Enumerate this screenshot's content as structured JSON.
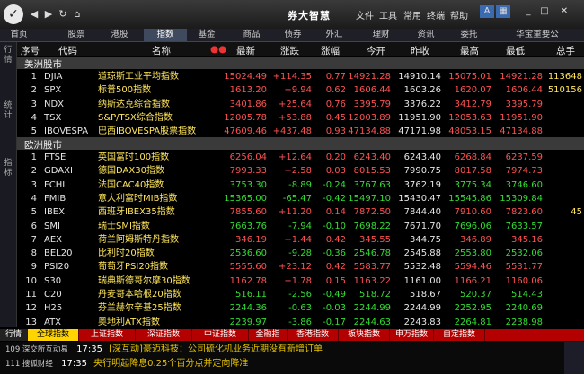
{
  "title": "券大智慧",
  "menu": [
    "文件",
    "工具",
    "常用",
    "终端",
    "帮助"
  ],
  "nav_tabs": [
    "首页",
    "股票",
    "港股",
    "指数",
    "基金",
    "商品",
    "债券",
    "外汇",
    "理财",
    "资讯",
    "委托",
    "华宝重要公"
  ],
  "sidebar_tabs": [
    "行情",
    "统计",
    "指标"
  ],
  "headers": [
    "序号",
    "代码",
    "名称",
    "最新",
    "涨跌",
    "涨幅",
    "今开",
    "昨收",
    "最高",
    "最低",
    "总手"
  ],
  "sections": {
    "americas": "美洲股市",
    "europe": "欧洲股市"
  },
  "americas": [
    {
      "n": "1",
      "code": "DJIA",
      "name": "道琼斯工业平均指数",
      "last": "15024.49",
      "chg": "+114.35",
      "pct": "0.77",
      "open": "14921.28",
      "prev": "14910.14",
      "high": "15075.01",
      "low": "14921.28",
      "vol": "113648",
      "dir": "up"
    },
    {
      "n": "2",
      "code": "SPX",
      "name": "标普500指数",
      "last": "1613.20",
      "chg": "+9.94",
      "pct": "0.62",
      "open": "1606.44",
      "prev": "1603.26",
      "high": "1620.07",
      "low": "1606.44",
      "vol": "510156",
      "dir": "up"
    },
    {
      "n": "3",
      "code": "NDX",
      "name": "纳斯达克综合指数",
      "last": "3401.86",
      "chg": "+25.64",
      "pct": "0.76",
      "open": "3395.79",
      "prev": "3376.22",
      "high": "3412.79",
      "low": "3395.79",
      "vol": "",
      "dir": "up"
    },
    {
      "n": "4",
      "code": "TSX",
      "name": "S&P/TSX综合指数",
      "last": "12005.78",
      "chg": "+53.88",
      "pct": "0.45",
      "open": "12003.89",
      "prev": "11951.90",
      "high": "12053.63",
      "low": "11951.90",
      "vol": "",
      "dir": "up"
    },
    {
      "n": "5",
      "code": "IBOVESPA",
      "name": "巴西IBOVESPA股票指数",
      "last": "47609.46",
      "chg": "+437.48",
      "pct": "0.93",
      "open": "47134.88",
      "prev": "47171.98",
      "high": "48053.15",
      "low": "47134.88",
      "vol": "",
      "dir": "up"
    }
  ],
  "europe": [
    {
      "n": "1",
      "code": "FTSE",
      "name": "英国富时100指数",
      "last": "6256.04",
      "chg": "+12.64",
      "pct": "0.20",
      "open": "6243.40",
      "prev": "6243.40",
      "high": "6268.84",
      "low": "6237.59",
      "vol": "",
      "dir": "up"
    },
    {
      "n": "2",
      "code": "GDAXI",
      "name": "德国DAX30指数",
      "last": "7993.33",
      "chg": "+2.58",
      "pct": "0.03",
      "open": "8015.53",
      "prev": "7990.75",
      "high": "8017.58",
      "low": "7974.73",
      "vol": "",
      "dir": "up"
    },
    {
      "n": "3",
      "code": "FCHI",
      "name": "法国CAC40指数",
      "last": "3753.30",
      "chg": "-8.89",
      "pct": "-0.24",
      "open": "3767.63",
      "prev": "3762.19",
      "high": "3775.34",
      "low": "3746.60",
      "vol": "",
      "dir": "dn"
    },
    {
      "n": "4",
      "code": "FMIB",
      "name": "意大利富时MIB指数",
      "last": "15365.00",
      "chg": "-65.47",
      "pct": "-0.42",
      "open": "15497.10",
      "prev": "15430.47",
      "high": "15545.86",
      "low": "15309.84",
      "vol": "",
      "dir": "dn"
    },
    {
      "n": "5",
      "code": "IBEX",
      "name": "西班牙IBEX35指数",
      "last": "7855.60",
      "chg": "+11.20",
      "pct": "0.14",
      "open": "7872.50",
      "prev": "7844.40",
      "high": "7910.60",
      "low": "7823.60",
      "vol": "45",
      "dir": "up"
    },
    {
      "n": "6",
      "code": "SMI",
      "name": "瑞士SMI指数",
      "last": "7663.76",
      "chg": "-7.94",
      "pct": "-0.10",
      "open": "7698.22",
      "prev": "7671.70",
      "high": "7696.06",
      "low": "7633.57",
      "vol": "",
      "dir": "dn"
    },
    {
      "n": "7",
      "code": "AEX",
      "name": "荷兰阿姆斯特丹指数",
      "last": "346.19",
      "chg": "+1.44",
      "pct": "0.42",
      "open": "345.55",
      "prev": "344.75",
      "high": "346.89",
      "low": "345.16",
      "vol": "",
      "dir": "up"
    },
    {
      "n": "8",
      "code": "BEL20",
      "name": "比利时20指数",
      "last": "2536.60",
      "chg": "-9.28",
      "pct": "-0.36",
      "open": "2546.78",
      "prev": "2545.88",
      "high": "2553.80",
      "low": "2532.06",
      "vol": "",
      "dir": "dn"
    },
    {
      "n": "9",
      "code": "PSI20",
      "name": "葡萄牙PSI20指数",
      "last": "5555.60",
      "chg": "+23.12",
      "pct": "0.42",
      "open": "5583.77",
      "prev": "5532.48",
      "high": "5594.46",
      "low": "5531.77",
      "vol": "",
      "dir": "up"
    },
    {
      "n": "10",
      "code": "S30",
      "name": "瑞典斯德哥尔摩30指数",
      "last": "1162.78",
      "chg": "+1.78",
      "pct": "0.15",
      "open": "1163.22",
      "prev": "1161.00",
      "high": "1166.21",
      "low": "1160.06",
      "vol": "",
      "dir": "up"
    },
    {
      "n": "11",
      "code": "C20",
      "name": "丹麦哥本哈根20指数",
      "last": "516.11",
      "chg": "-2.56",
      "pct": "-0.49",
      "open": "518.72",
      "prev": "518.67",
      "high": "520.37",
      "low": "514.43",
      "vol": "",
      "dir": "dn"
    },
    {
      "n": "12",
      "code": "H25",
      "name": "芬兰赫尔辛基25指数",
      "last": "2244.36",
      "chg": "-0.63",
      "pct": "-0.03",
      "open": "2244.99",
      "prev": "2244.99",
      "high": "2252.95",
      "low": "2240.69",
      "vol": "",
      "dir": "dn"
    },
    {
      "n": "13",
      "code": "ATX",
      "name": "奥地利ATX指数",
      "last": "2239.97",
      "chg": "-3.86",
      "pct": "-0.17",
      "open": "2244.63",
      "prev": "2243.83",
      "high": "2264.81",
      "low": "2238.98",
      "vol": "",
      "dir": "dn"
    }
  ],
  "bottom_tabs": [
    "行情",
    "全球指数",
    "上证指数",
    "深证指数",
    "中证指数",
    "金融指",
    "香港指数",
    "板块指数",
    "申万指数",
    "自定指数"
  ],
  "news": [
    {
      "src": "109 深交所互动易",
      "time": "17:35",
      "text": "[深互动]豪迈科技：公司硫化机业务近期没有新增订单"
    },
    {
      "src": "111 搜狐财经",
      "time": "17:35",
      "text": "央行明起降息0.25个百分点并定向降准"
    }
  ]
}
